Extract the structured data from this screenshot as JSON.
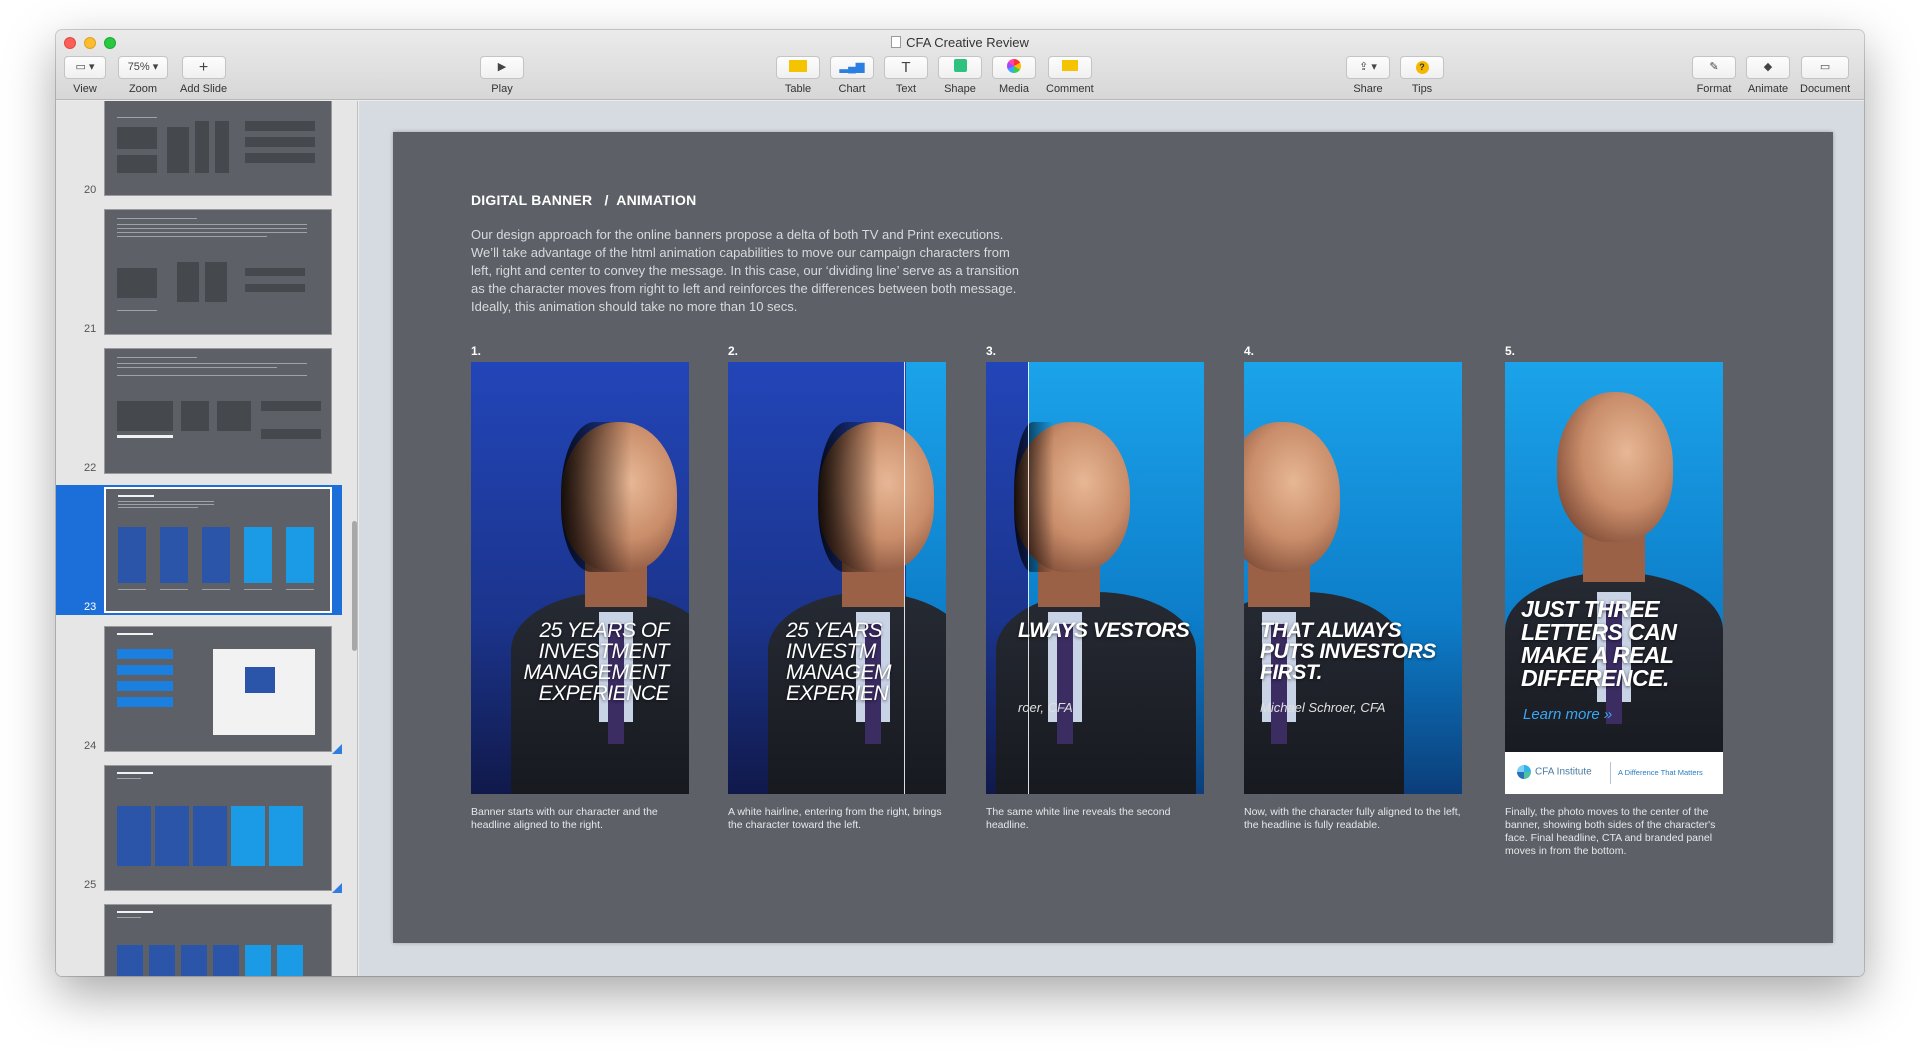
{
  "window": {
    "title": "CFA Creative Review"
  },
  "toolbar": {
    "view": {
      "label": "View"
    },
    "zoom": {
      "label": "Zoom",
      "value": "75%"
    },
    "add_slide": {
      "label": "Add Slide"
    },
    "play": {
      "label": "Play"
    },
    "table": {
      "label": "Table"
    },
    "chart": {
      "label": "Chart"
    },
    "text": {
      "label": "Text"
    },
    "shape": {
      "label": "Shape"
    },
    "media": {
      "label": "Media"
    },
    "comment": {
      "label": "Comment"
    },
    "share": {
      "label": "Share"
    },
    "tips": {
      "label": "Tips"
    },
    "format": {
      "label": "Format"
    },
    "animate": {
      "label": "Animate"
    },
    "document": {
      "label": "Document"
    }
  },
  "sidebar": {
    "slides": [
      {
        "number": "20"
      },
      {
        "number": "21"
      },
      {
        "number": "22"
      },
      {
        "number": "23",
        "selected": true
      },
      {
        "number": "24"
      },
      {
        "number": "25"
      }
    ]
  },
  "slide": {
    "title": "DIGITAL BANNER   /  ANIMATION",
    "body": "Our design approach for the online banners propose a delta of both TV and Print executions. We’ll take advantage of the html animation capabilities to move our campaign characters from left, right and center to convey the message. In this case, our ‘dividing line’ serve as a transition as the character moves from right to left and reinforces the differences between both message. Ideally, this animation should take no more than 10 secs.",
    "steps": [
      {
        "number": "1.",
        "headline": "25 YEARS OF INVESTMENT MANAGEMENT EXPERIENCE",
        "caption": "Banner starts with our character and the headline aligned to the right."
      },
      {
        "number": "2.",
        "headline": "25 YEARS INVESTM MANAGEM EXPERIEN",
        "caption": "A white hairline, entering from the right, brings the character toward the left."
      },
      {
        "number": "3.",
        "headline": "LWAYS VESTORS",
        "signature": "roer, CFA",
        "caption": "The same white line reveals the second headline."
      },
      {
        "number": "4.",
        "headline": "THAT ALWAYS PUTS INVESTORS FIRST.",
        "signature": "Michael Schroer, CFA",
        "caption": "Now, with the character fully aligned to the left, the headline is fully readable."
      },
      {
        "number": "5.",
        "headline": "JUST THREE LETTERS CAN MAKE A REAL DIFFERENCE.",
        "cta": "Learn more »",
        "brand": "CFA Institute",
        "tagline": "A Difference That Matters",
        "caption": "Finally, the photo moves to the center of the banner, showing both sides of the character's face. Final headline, CTA and branded panel moves in from the bottom."
      }
    ]
  },
  "colors": {
    "slide_bg": "#5d6066",
    "selection": "#1c6fd8",
    "banner_blue": "#2245b8",
    "banner_cyan": "#1ba3ea",
    "cta": "#3aa6f2"
  }
}
